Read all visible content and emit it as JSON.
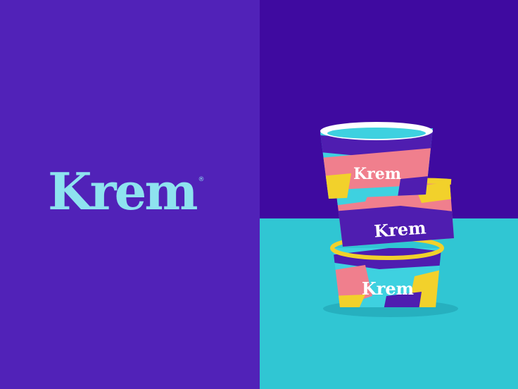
{
  "brand": {
    "name": "Krem",
    "registered_mark": "®"
  },
  "cups": [
    {
      "label": "Krem"
    },
    {
      "label": "Krem"
    },
    {
      "label": "Krem"
    }
  ],
  "colors": {
    "left_background": "#5122b8",
    "right_wall": "#3f0aa0",
    "right_floor": "#30c6d3",
    "logo": "#8ee3ef",
    "cup_pink": "#f07f8d",
    "cup_yellow": "#f2d12b",
    "cup_purple": "#4f1db0",
    "cup_cyan": "#3ed1e0"
  }
}
